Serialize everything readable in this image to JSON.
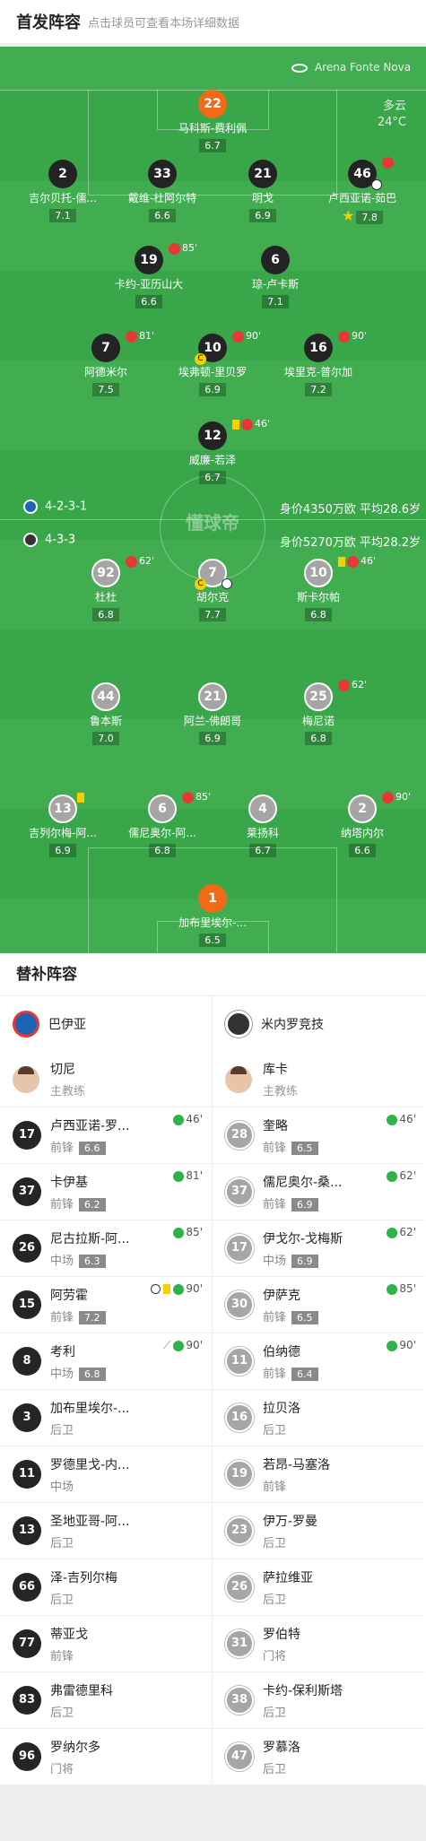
{
  "header": {
    "title": "首发阵容",
    "subtitle": "点击球员可查看本场详细数据"
  },
  "pitch": {
    "stadium": "Arena Fonte Nova",
    "weather": "多云",
    "temp": "24°C",
    "watermark": "懂球帝",
    "home": {
      "formation": "4-2-3-1",
      "value": "身价4350万欧 平均28.6岁",
      "color": "#1e64b4"
    },
    "away": {
      "formation": "4-3-3",
      "value": "身价5270万欧 平均28.2岁",
      "color": "#333333"
    }
  },
  "home_players": [
    {
      "num": "22",
      "name": "马科斯-费利佩",
      "rating": "6.7",
      "style": "g"
    },
    {
      "num": "2",
      "name": "吉尔贝托-儒...",
      "rating": "7.1",
      "style": "d"
    },
    {
      "num": "33",
      "name": "戴维-杜阿尔特",
      "rating": "6.6",
      "style": "d"
    },
    {
      "num": "21",
      "name": "明戈",
      "rating": "6.9",
      "style": "d"
    },
    {
      "num": "46",
      "name": "卢西亚诺-茹巴",
      "rating": "7.8",
      "style": "d",
      "mark": "",
      "ball": true,
      "star": true
    },
    {
      "num": "19",
      "name": "卡约-亚历山大",
      "rating": "6.6",
      "style": "d",
      "mark": "85'"
    },
    {
      "num": "6",
      "name": "琼-卢卡斯",
      "rating": "7.1",
      "style": "d"
    },
    {
      "num": "7",
      "name": "阿德米尔",
      "rating": "7.5",
      "style": "d",
      "mark": "81'"
    },
    {
      "num": "10",
      "name": "埃弗顿-里贝罗",
      "rating": "6.9",
      "style": "d",
      "mark": "90'",
      "cap": "C"
    },
    {
      "num": "16",
      "name": "埃里克-普尔加",
      "rating": "7.2",
      "style": "d",
      "mark": "90'"
    },
    {
      "num": "12",
      "name": "威廉-若泽",
      "rating": "6.7",
      "style": "d",
      "mark": "46'",
      "yellow": true
    }
  ],
  "away_players": [
    {
      "num": "92",
      "name": "杜杜",
      "rating": "6.8",
      "style": "a",
      "mark": "62'"
    },
    {
      "num": "7",
      "name": "胡尔克",
      "rating": "7.7",
      "style": "a",
      "cap": "C",
      "ball": true
    },
    {
      "num": "10",
      "name": "斯卡尔帕",
      "rating": "6.8",
      "style": "a",
      "mark": "46'",
      "yellow": true
    },
    {
      "num": "44",
      "name": "鲁本斯",
      "rating": "7.0",
      "style": "a"
    },
    {
      "num": "21",
      "name": "阿兰-佛朗哥",
      "rating": "6.9",
      "style": "a"
    },
    {
      "num": "25",
      "name": "梅尼诺",
      "rating": "6.8",
      "style": "a",
      "mark": "62'"
    },
    {
      "num": "13",
      "name": "吉列尔梅-阿...",
      "rating": "6.9",
      "style": "a",
      "yellow": true
    },
    {
      "num": "6",
      "name": "儒尼奥尔-阿...",
      "rating": "6.8",
      "style": "a",
      "mark": "85'"
    },
    {
      "num": "4",
      "name": "莱扬科",
      "rating": "6.7",
      "style": "a"
    },
    {
      "num": "2",
      "name": "纳塔内尔",
      "rating": "6.6",
      "style": "a",
      "mark": "90'"
    },
    {
      "num": "1",
      "name": "加布里埃尔-...",
      "rating": "6.5",
      "style": "g"
    }
  ],
  "subs": {
    "title": "替补阵容",
    "home": {
      "team": "巴伊亚",
      "coach": "切尼",
      "coach_role": "主教练",
      "logo": "#1e64b4",
      "players": [
        {
          "num": "17",
          "name": "卢西亚诺-罗...",
          "pos": "前锋",
          "rating": "6.6",
          "min": "46'"
        },
        {
          "num": "37",
          "name": "卡伊基",
          "pos": "前锋",
          "rating": "6.2",
          "min": "81'"
        },
        {
          "num": "26",
          "name": "尼古拉斯-阿...",
          "pos": "中场",
          "rating": "6.3",
          "min": "85'"
        },
        {
          "num": "15",
          "name": "阿劳霍",
          "pos": "前锋",
          "rating": "7.2",
          "min": "90'",
          "goal": true,
          "yellow": true
        },
        {
          "num": "8",
          "name": "考利",
          "pos": "中场",
          "rating": "6.8",
          "min": "90'",
          "assist": true
        },
        {
          "num": "3",
          "name": "加布里埃尔-...",
          "pos": "后卫"
        },
        {
          "num": "11",
          "name": "罗德里戈-内...",
          "pos": "中场"
        },
        {
          "num": "13",
          "name": "圣地亚哥-阿...",
          "pos": "后卫"
        },
        {
          "num": "66",
          "name": "泽-吉列尔梅",
          "pos": "后卫"
        },
        {
          "num": "77",
          "name": "蒂亚戈",
          "pos": "前锋"
        },
        {
          "num": "83",
          "name": "弗雷德里科",
          "pos": "后卫"
        },
        {
          "num": "96",
          "name": "罗纳尔多",
          "pos": "门将"
        }
      ]
    },
    "away": {
      "team": "米内罗竞技",
      "coach": "库卡",
      "coach_role": "主教练",
      "logo": "#333333",
      "players": [
        {
          "num": "28",
          "name": "奎略",
          "pos": "前锋",
          "rating": "6.5",
          "min": "46'"
        },
        {
          "num": "37",
          "name": "儒尼奥尔-桑...",
          "pos": "前锋",
          "rating": "6.9",
          "min": "62'"
        },
        {
          "num": "17",
          "name": "伊戈尔-戈梅斯",
          "pos": "中场",
          "rating": "6.9",
          "min": "62'"
        },
        {
          "num": "30",
          "name": "伊萨克",
          "pos": "前锋",
          "rating": "6.5",
          "min": "85'"
        },
        {
          "num": "11",
          "name": "伯纳德",
          "pos": "前锋",
          "rating": "6.4",
          "min": "90'"
        },
        {
          "num": "16",
          "name": "拉贝洛",
          "pos": "后卫"
        },
        {
          "num": "19",
          "name": "若昂-马塞洛",
          "pos": "前锋"
        },
        {
          "num": "23",
          "name": "伊万-罗曼",
          "pos": "后卫"
        },
        {
          "num": "26",
          "name": "萨拉维亚",
          "pos": "后卫"
        },
        {
          "num": "31",
          "name": "罗伯特",
          "pos": "门将"
        },
        {
          "num": "38",
          "name": "卡约-保利斯塔",
          "pos": "后卫"
        },
        {
          "num": "47",
          "name": "罗慕洛",
          "pos": "后卫"
        }
      ]
    }
  }
}
